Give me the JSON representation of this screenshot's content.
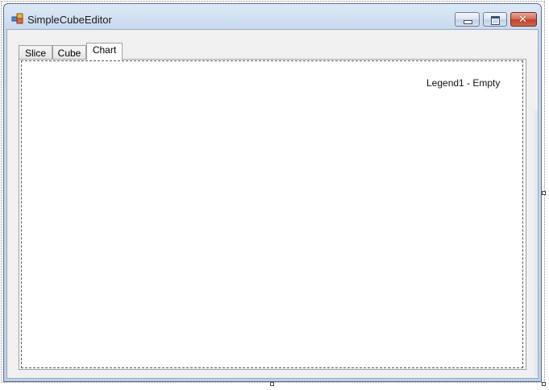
{
  "window": {
    "title": "SimpleCubeEditor",
    "icon": "app-cubes-icon",
    "controls": [
      "minimize-icon",
      "maximize-icon",
      "close-icon"
    ]
  },
  "tabs": [
    {
      "label": "Slice",
      "selected": false
    },
    {
      "label": "Cube",
      "selected": false
    },
    {
      "label": "Chart",
      "selected": true
    }
  ],
  "chart": {
    "legend_text": "Legend1 - Empty"
  },
  "colors": {
    "titlebar": "#c9daef",
    "client_bg": "#f0f0f0",
    "close_button": "#c2412a"
  }
}
